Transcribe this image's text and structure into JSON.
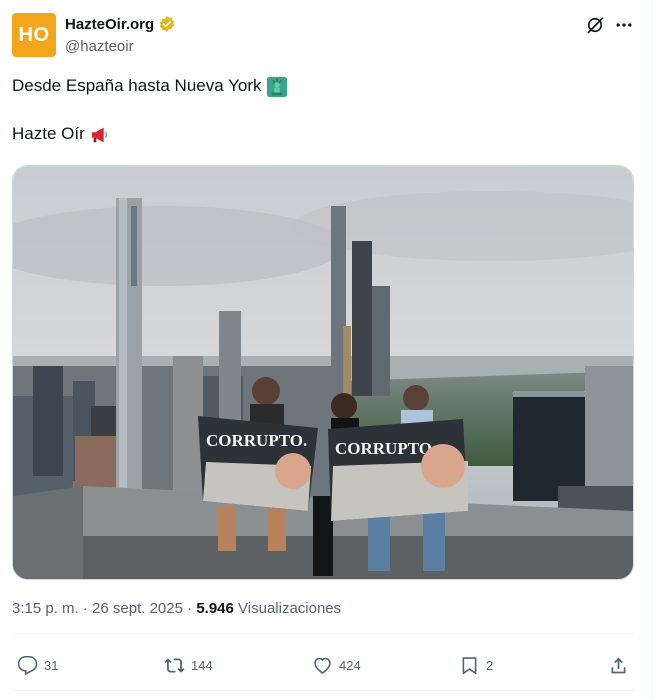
{
  "author": {
    "avatar_text": "HO",
    "display_name": "HazteOir.org",
    "handle": "@hazteoir",
    "verified_badge": "gold-verified-icon",
    "avatar_color": "#f5a51a"
  },
  "tweet": {
    "line1": "Desde España hasta Nueva York",
    "line1_emoji": "statue-of-liberty-icon",
    "line2": "Hazte Oír",
    "line2_emoji": "megaphone-icon"
  },
  "photo": {
    "banner_text": "CORRUPTO.",
    "description": "photo"
  },
  "meta": {
    "time": "3:15 p. m.",
    "separator": "·",
    "date": "26 sept. 2025",
    "views_count": "5.946",
    "views_label": "Visualizaciones"
  },
  "actions": {
    "reply_count": "31",
    "repost_count": "144",
    "like_count": "424",
    "bookmark_count": "2"
  },
  "colors": {
    "text": "#0f1419",
    "secondary": "#536471",
    "border": "#eff3f4"
  }
}
